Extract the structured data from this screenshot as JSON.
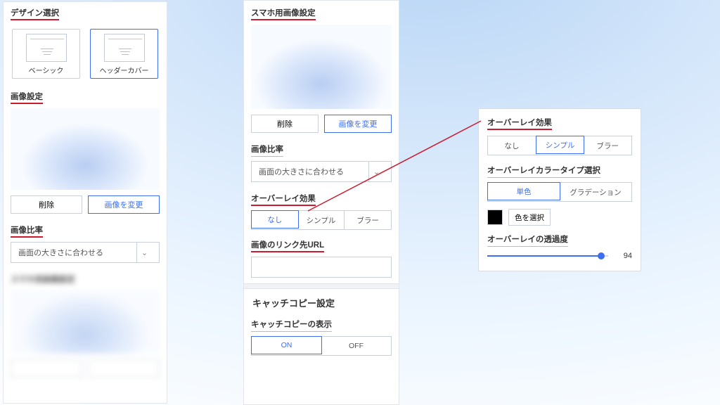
{
  "left": {
    "design_select_title": "デザイン選択",
    "tile_basic": "ベーシック",
    "tile_header_cover": "ヘッダーカバー",
    "image_settings_title": "画像設定",
    "btn_delete": "削除",
    "btn_change_image": "画像を変更",
    "image_ratio_title": "画像比率",
    "ratio_select_value": "画面の大きさに合わせる"
  },
  "mid": {
    "smartphone_image_title": "スマホ用画像設定",
    "btn_delete": "削除",
    "btn_change_image": "画像を変更",
    "image_ratio_title": "画像比率",
    "ratio_select_value": "画面の大きさに合わせる",
    "overlay_effect_title": "オーバーレイ効果",
    "overlay_none": "なし",
    "overlay_simple": "シンプル",
    "overlay_blur": "ブラー",
    "link_url_title": "画像のリンク先URL",
    "catch_copy_section": "キャッチコピー設定",
    "catch_copy_show_title": "キャッチコピーの表示",
    "toggle_on": "ON",
    "toggle_off": "OFF"
  },
  "right": {
    "overlay_effect_title": "オーバーレイ効果",
    "overlay_none": "なし",
    "overlay_simple": "シンプル",
    "overlay_blur": "ブラー",
    "color_type_title": "オーバーレイカラータイプ選択",
    "color_solid": "単色",
    "color_gradation": "グラデーション",
    "color_select_btn": "色を選択",
    "opacity_title": "オーバーレイの透過度",
    "opacity_value": "94"
  }
}
